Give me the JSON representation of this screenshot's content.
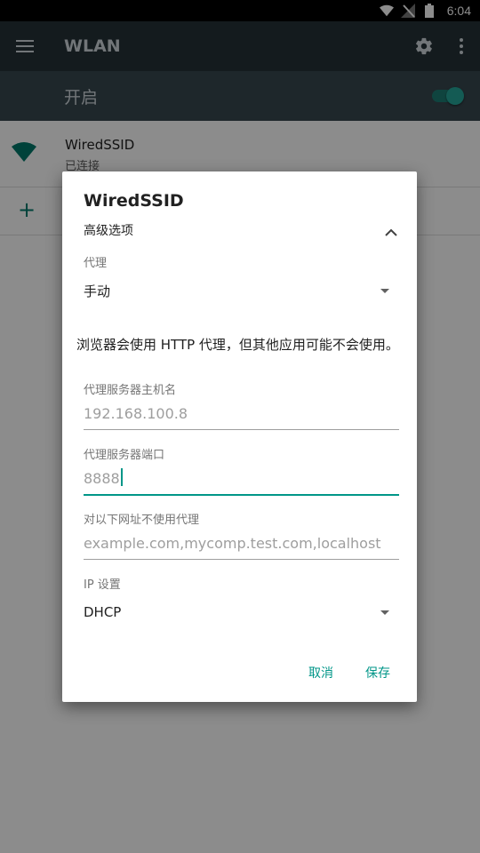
{
  "status_bar": {
    "time": "6:04"
  },
  "app_bar": {
    "title": "WLAN"
  },
  "master_switch": {
    "label": "开启",
    "state": "on"
  },
  "networks": [
    {
      "name": "WiredSSID",
      "status": "已连接"
    }
  ],
  "dialog": {
    "title": "WiredSSID",
    "advanced_options_label": "高级选项",
    "proxy_caption": "代理",
    "proxy_value": "手动",
    "warning": "浏览器会使用 HTTP 代理，但其他应用可能不会使用。",
    "proxy_host_caption": "代理服务器主机名",
    "proxy_host_value": "192.168.100.8",
    "proxy_port_caption": "代理服务器端口",
    "proxy_port_value": "8888",
    "bypass_caption": "对以下网址不使用代理",
    "bypass_placeholder": "example.com,mycomp.test.com,localhost",
    "ip_caption": "IP 设置",
    "ip_value": "DHCP",
    "cancel_label": "取消",
    "save_label": "保存"
  },
  "colors": {
    "app_bar": "#263238",
    "switch_row": "#37474f",
    "accent": "#009688"
  }
}
